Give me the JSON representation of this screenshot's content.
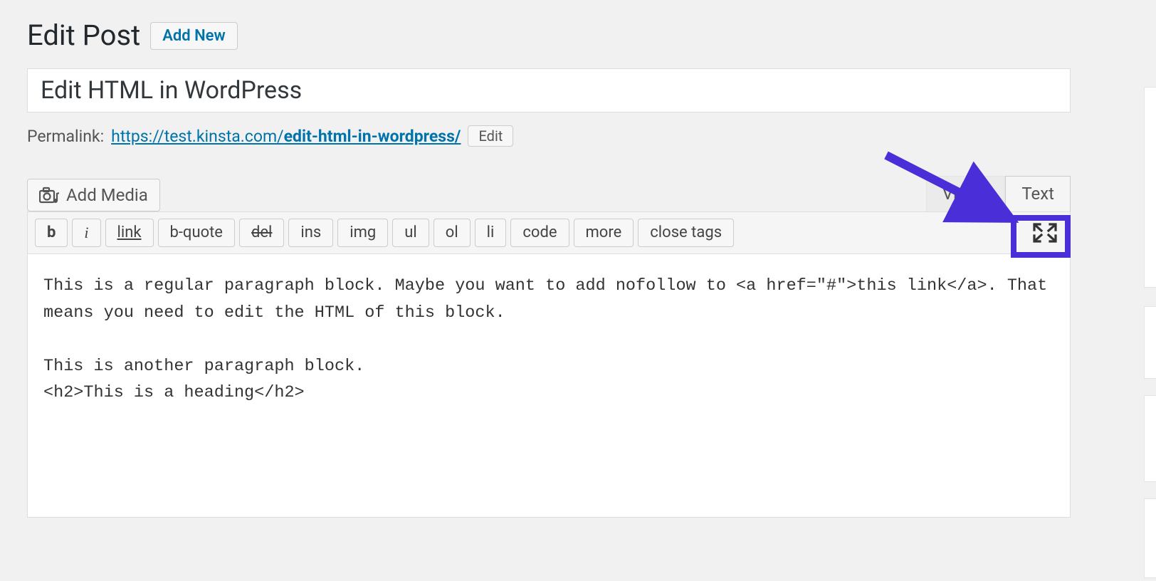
{
  "heading": {
    "title": "Edit Post",
    "add_new": "Add New"
  },
  "post_title": "Edit HTML in WordPress",
  "permalink": {
    "label": "Permalink:",
    "base_url": "https://test.kinsta.com/",
    "slug": "edit-html-in-wordpress/",
    "edit_label": "Edit"
  },
  "add_media_label": "Add Media",
  "tabs": {
    "visual": "Visual",
    "text": "Text"
  },
  "quicktags": {
    "b": "b",
    "i": "i",
    "link": "link",
    "bquote": "b-quote",
    "del": "del",
    "ins": "ins",
    "img": "img",
    "ul": "ul",
    "ol": "ol",
    "li": "li",
    "code": "code",
    "more": "more",
    "close": "close tags"
  },
  "content": "This is a regular paragraph block. Maybe you want to add nofollow to <a href=\"#\">this link</a>. That means you need to edit the HTML of this block.\n\nThis is another paragraph block.\n<h2>This is a heading</h2>"
}
